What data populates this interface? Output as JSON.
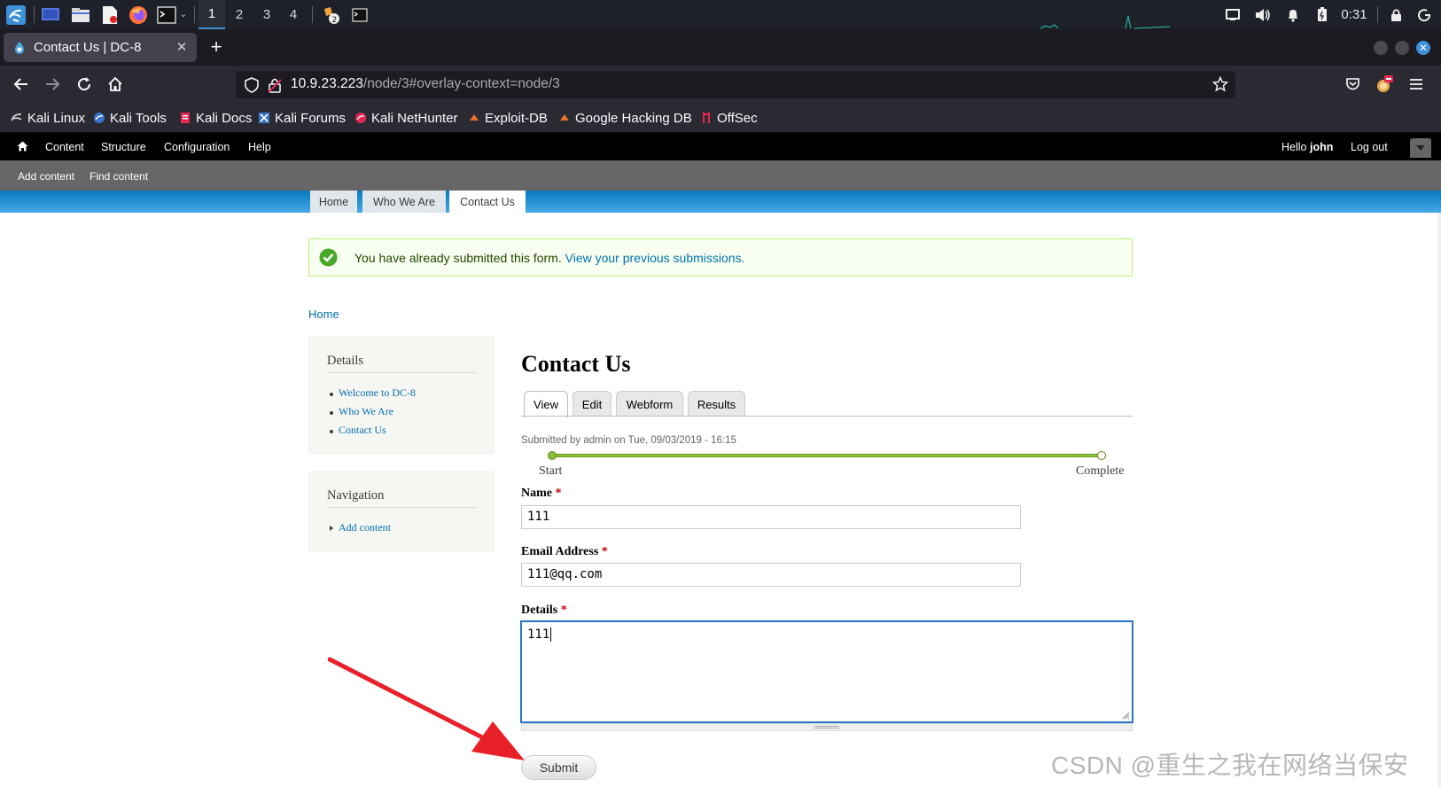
{
  "taskbar": {
    "workspaces": [
      "1",
      "2",
      "3",
      "4"
    ],
    "active_workspace": "1",
    "clock": "0:31"
  },
  "browser": {
    "tab_title": "Contact Us | DC-8",
    "url_host": "10.9.23.223",
    "url_path": "/node/3#overlay-context=node/3",
    "bookmarks": [
      "Kali Linux",
      "Kali Tools",
      "Kali Docs",
      "Kali Forums",
      "Kali NetHunter",
      "Exploit-DB",
      "Google Hacking DB",
      "OffSec"
    ]
  },
  "admin_bar": {
    "items": [
      "Content",
      "Structure",
      "Configuration",
      "Help"
    ],
    "hello_prefix": "Hello",
    "username": "john",
    "logout": "Log out"
  },
  "shortcuts": [
    "Add content",
    "Find content"
  ],
  "main_menu": [
    "Home",
    "Who We Are",
    "Contact Us"
  ],
  "message": {
    "text": "You have already submitted this form.",
    "link": "View your previous submissions."
  },
  "breadcrumb": "Home",
  "sidebar": {
    "details_title": "Details",
    "details_links": [
      "Welcome to DC-8",
      "Who We Are",
      "Contact Us"
    ],
    "nav_title": "Navigation",
    "nav_links": [
      "Add content"
    ]
  },
  "page": {
    "title": "Contact Us",
    "tabs": [
      "View",
      "Edit",
      "Webform",
      "Results"
    ],
    "active_tab": "View",
    "submitted": "Submitted by admin on Tue, 09/03/2019 - 16:15",
    "progress_start": "Start",
    "progress_end": "Complete"
  },
  "form": {
    "name_label": "Name",
    "name_value": "111",
    "email_label": "Email Address",
    "email_value": "111@qq.com",
    "details_label": "Details",
    "details_value": "111",
    "required_mark": "*",
    "submit_label": "Submit"
  },
  "watermark": "CSDN @重生之我在网络当保安",
  "colors": {
    "drupal_link": "#0071b3",
    "header_blue": "#0779bf",
    "message_border": "#bbee77",
    "arrow_red": "#e8202a",
    "focus_blue": "#2a73c9"
  }
}
